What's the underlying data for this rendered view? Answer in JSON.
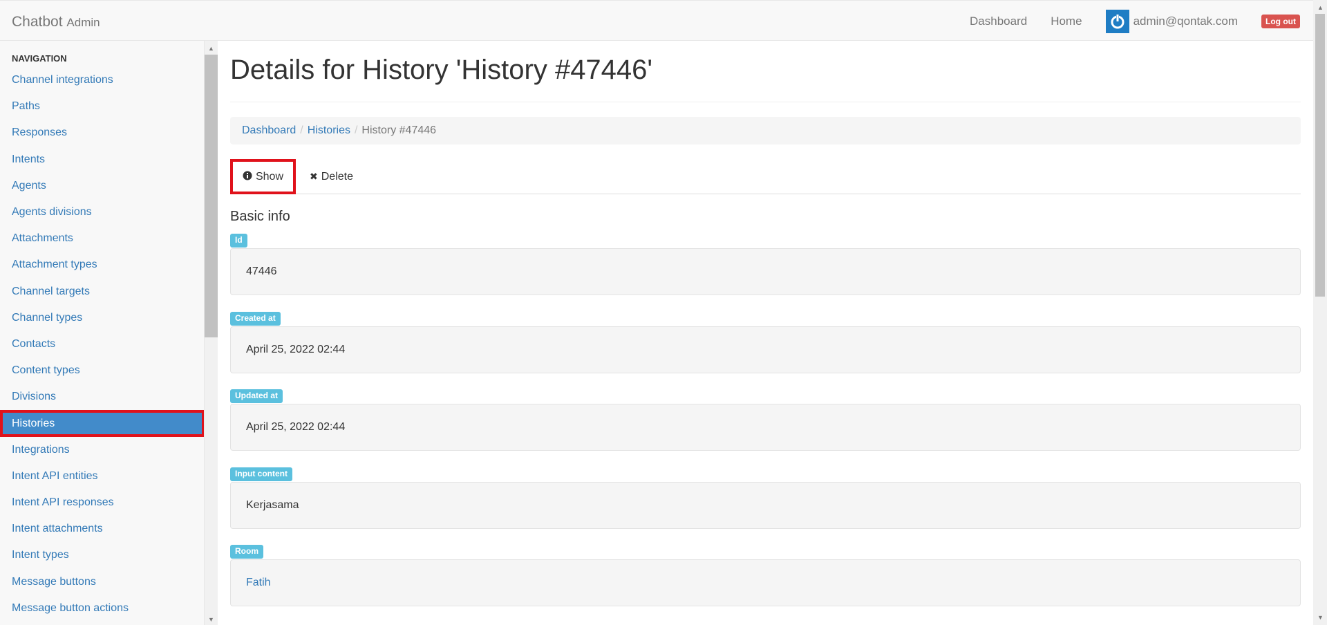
{
  "navbar": {
    "brand": "Chatbot",
    "brand_sub": "Admin",
    "links": [
      "Dashboard",
      "Home"
    ],
    "user": "admin@qontak.com",
    "logout": "Log out"
  },
  "sidebar": {
    "header": "NAVIGATION",
    "items": [
      {
        "label": "Channel integrations"
      },
      {
        "label": "Paths"
      },
      {
        "label": "Responses"
      },
      {
        "label": "Intents"
      },
      {
        "label": "Agents"
      },
      {
        "label": "Agents divisions"
      },
      {
        "label": "Attachments"
      },
      {
        "label": "Attachment types"
      },
      {
        "label": "Channel targets"
      },
      {
        "label": "Channel types"
      },
      {
        "label": "Contacts"
      },
      {
        "label": "Content types"
      },
      {
        "label": "Divisions"
      },
      {
        "label": "Histories"
      },
      {
        "label": "Integrations"
      },
      {
        "label": "Intent API entities"
      },
      {
        "label": "Intent API responses"
      },
      {
        "label": "Intent attachments"
      },
      {
        "label": "Intent types"
      },
      {
        "label": "Message buttons"
      },
      {
        "label": "Message button actions"
      }
    ],
    "active_index": 13
  },
  "main": {
    "title": "Details for History 'History #47446'",
    "breadcrumb": {
      "items": [
        "Dashboard",
        "Histories"
      ],
      "active": "History #47446"
    },
    "tabs": {
      "show": "Show",
      "delete": "Delete"
    },
    "section_title": "Basic info",
    "fields": [
      {
        "label": "Id",
        "value": "47446"
      },
      {
        "label": "Created at",
        "value": "April 25, 2022 02:44"
      },
      {
        "label": "Updated at",
        "value": "April 25, 2022 02:44"
      },
      {
        "label": "Input content",
        "value": "Kerjasama"
      },
      {
        "label": "Room",
        "value": "Fatih"
      }
    ]
  },
  "colors": {
    "link": "#337ab7",
    "active_bg": "#428bca",
    "highlight": "#e0121b",
    "label_bg": "#5bc0de",
    "logout_bg": "#d9534f"
  }
}
